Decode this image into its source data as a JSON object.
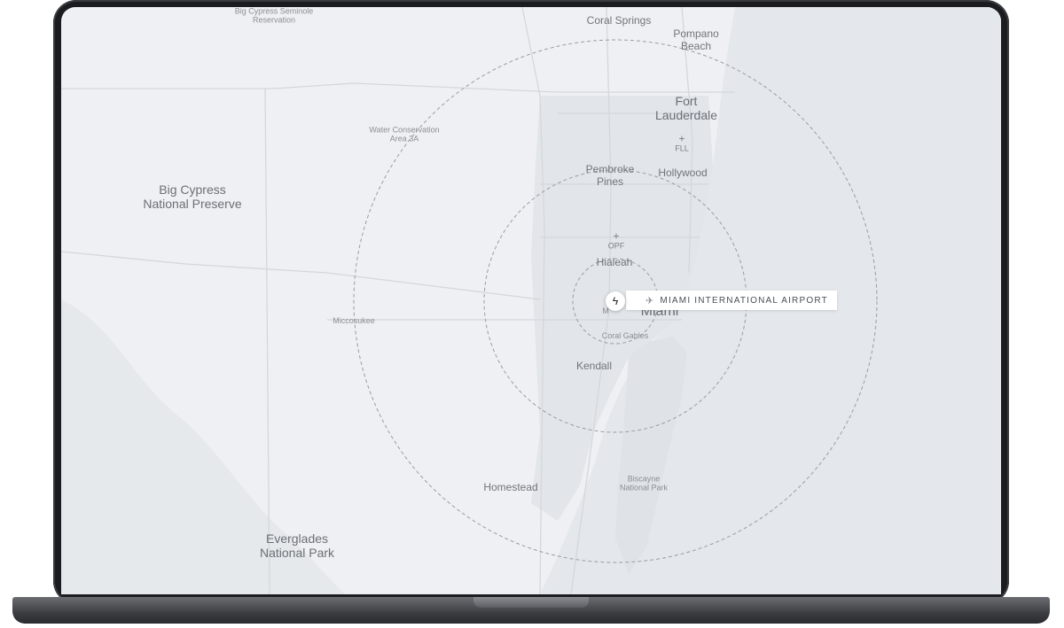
{
  "map": {
    "center_label": "Miami",
    "focused_airport": {
      "name": "MIAMI INTERNATIONAL AIRPORT",
      "marker_icon": "bolt-icon",
      "tag_icon": "airplane-icon"
    },
    "places": [
      {
        "id": "big-cypress-seminole",
        "text": "Big Cypress Seminole\nReservation"
      },
      {
        "id": "coral-springs",
        "text": "Coral Springs"
      },
      {
        "id": "pompano-beach",
        "text": "Pompano\nBeach"
      },
      {
        "id": "fort-lauderdale",
        "text": "Fort\nLauderdale"
      },
      {
        "id": "water-conservation",
        "text": "Water Conservation\nArea 3A"
      },
      {
        "id": "big-cypress-preserve",
        "text": "Big Cypress\nNational Preserve"
      },
      {
        "id": "pembroke-pines",
        "text": "Pembroke\nPines"
      },
      {
        "id": "hollywood",
        "text": "Hollywood"
      },
      {
        "id": "hialeah",
        "text": "Hialeah"
      },
      {
        "id": "miccosukee",
        "text": "Miccosukee"
      },
      {
        "id": "miami",
        "text": "Miami"
      },
      {
        "id": "miami-small",
        "text": "M"
      },
      {
        "id": "coral-gables",
        "text": "Coral Gables"
      },
      {
        "id": "kendall",
        "text": "Kendall"
      },
      {
        "id": "homestead",
        "text": "Homestead"
      },
      {
        "id": "biscayne",
        "text": "Biscayne\nNational Park"
      },
      {
        "id": "everglades",
        "text": "Everglades\nNational Park"
      }
    ],
    "airports": [
      {
        "code": "FLL"
      },
      {
        "code": "OPF"
      }
    ],
    "colors": {
      "land": "#eef0f3",
      "water": "#e3e6ea",
      "urban": "#dfe2e6",
      "roads": "#d3d6da",
      "ring": "#9a9da3"
    }
  }
}
